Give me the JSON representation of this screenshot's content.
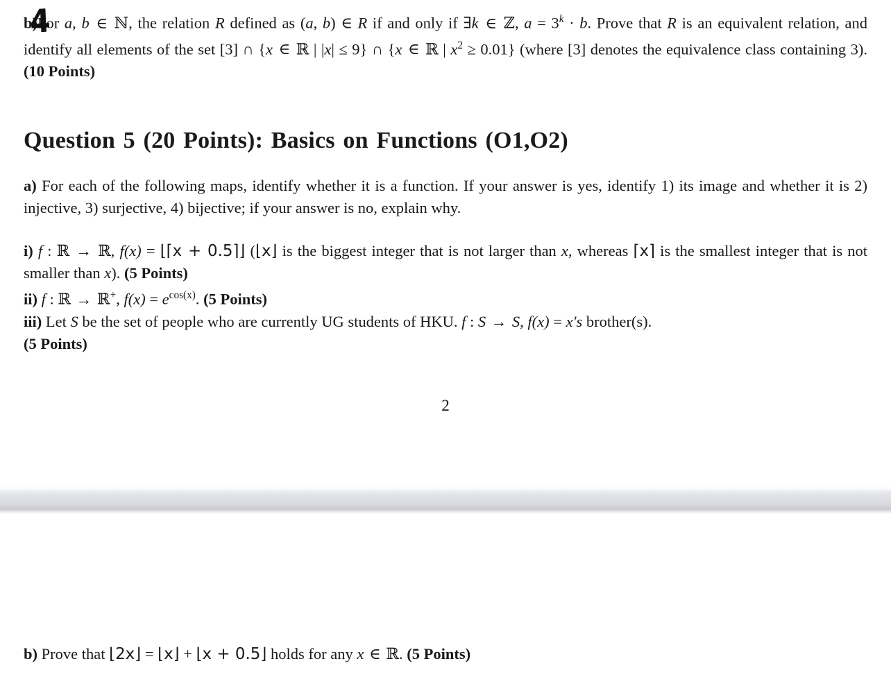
{
  "document": {
    "viewer_background": "#ffffff",
    "page_separator_color": "#d9dade",
    "annotation_color": "#111111"
  },
  "annotations": {
    "handwritten_mark": "4"
  },
  "page_one": {
    "question4b": {
      "label": "b)",
      "line1_a": "For ",
      "var_a": "a",
      "comma1": ", ",
      "var_b": "b",
      "in1": " ∈ ",
      "set_N": "ℕ",
      "line1_b": ", the relation ",
      "var_R1": "R",
      "line1_c": " defined as (",
      "var_a2": "a",
      "comma2": ", ",
      "var_b2": "b",
      "line1_d": ") ∈ ",
      "var_R2": "R",
      "line1_e": " if and only if ∃",
      "var_k": "k",
      "in2": " ∈ ",
      "set_Z": "ℤ",
      "comma3": ",  ",
      "var_a3": "a",
      "eq1": " = 3",
      "sup_k": "k",
      "dot": " · ",
      "var_b3": "b",
      "line1_f": ".  Prove that ",
      "var_R3": "R",
      "line1_g": " is an equivalent relation, and identify all elements of the set [3] ∩ {",
      "var_x1": "x",
      "line2_a": " ∈ ",
      "set_R1": "ℝ",
      "line2_b": " | |",
      "var_x2": "x",
      "line2_c": "| ≤ 9} ∩ {",
      "var_x3": "x",
      "line2_d": " ∈ ",
      "set_R2": "ℝ",
      "line2_e": " | ",
      "var_x4": "x",
      "sup_2": "2",
      "line2_f": " ≥ 0.01}",
      "line3": " (where [3] denotes the equivalence class containing 3). ",
      "points": "(10 Points)"
    },
    "question5_title": "Question 5 (20 Points): Basics on Functions (O1,O2)",
    "part_a": {
      "label": "a)",
      "text": " For each of the following maps, identify whether it is a function. If your answer is yes, identify 1) its image and whether it is 2) injective, 3) surjective, 4) bijective; if your answer is no, explain why."
    },
    "item_i": {
      "label": "i)",
      "fn_f": "f",
      "colon": " : ",
      "set_R_dom": "ℝ",
      "arrow": " → ",
      "set_R_cod": "ℝ",
      "comma": ",  ",
      "fx": "f",
      "fx_arg": "(x)",
      "equals": " = ",
      "formula": "⌊⌈x + 0.5⌉⌋",
      "note_open": " (",
      "floor_x": "⌊x⌋",
      "note_mid": " is the biggest integer that is not larger than ",
      "var_x": "x",
      "note_whereas": ", whereas ",
      "ceil_x": "⌈x⌉",
      "note_end": " is the smallest integer that is not smaller than ",
      "var_x2": "x",
      "close": "). ",
      "points": "(5 Points)"
    },
    "item_ii": {
      "label": "ii)",
      "fn_f": "f",
      "colon": " : ",
      "set_R_dom": "ℝ",
      "arrow": " → ",
      "set_R_cod": "ℝ",
      "superscript_plus": "+",
      "comma": ",  ",
      "fx": "f",
      "fx_arg": "(x)",
      "equals": " = ",
      "base_e": "e",
      "exponent": "cos(x)",
      "period": ". ",
      "points": "(5 Points)"
    },
    "item_iii": {
      "label": "iii)",
      "text_a": " Let ",
      "var_S1": "S",
      "text_b": " be the set of people who are currently UG students of HKU. ",
      "fn_f": "f",
      "colon": " : ",
      "var_S2": "S",
      "arrow": " → ",
      "var_S3": "S",
      "comma": ",  ",
      "fx": "f",
      "fx_arg": "(x)",
      "equals": " = ",
      "var_x_prime": "x′s",
      "text_c": " brother(s).",
      "points": "(5 Points)"
    },
    "page_number": "2"
  },
  "page_two": {
    "part_b": {
      "label": "b)",
      "text_a": " Prove that ",
      "lhs": "⌊2x⌋",
      "equals": " = ",
      "rhs1": "⌊x⌋",
      "plus": " + ",
      "rhs2": "⌊x + 0.5⌋",
      "text_b": " holds for any ",
      "var_x": "x",
      "in": " ∈ ",
      "set_R": "ℝ",
      "period": ". ",
      "points": "(5 Points)"
    }
  }
}
